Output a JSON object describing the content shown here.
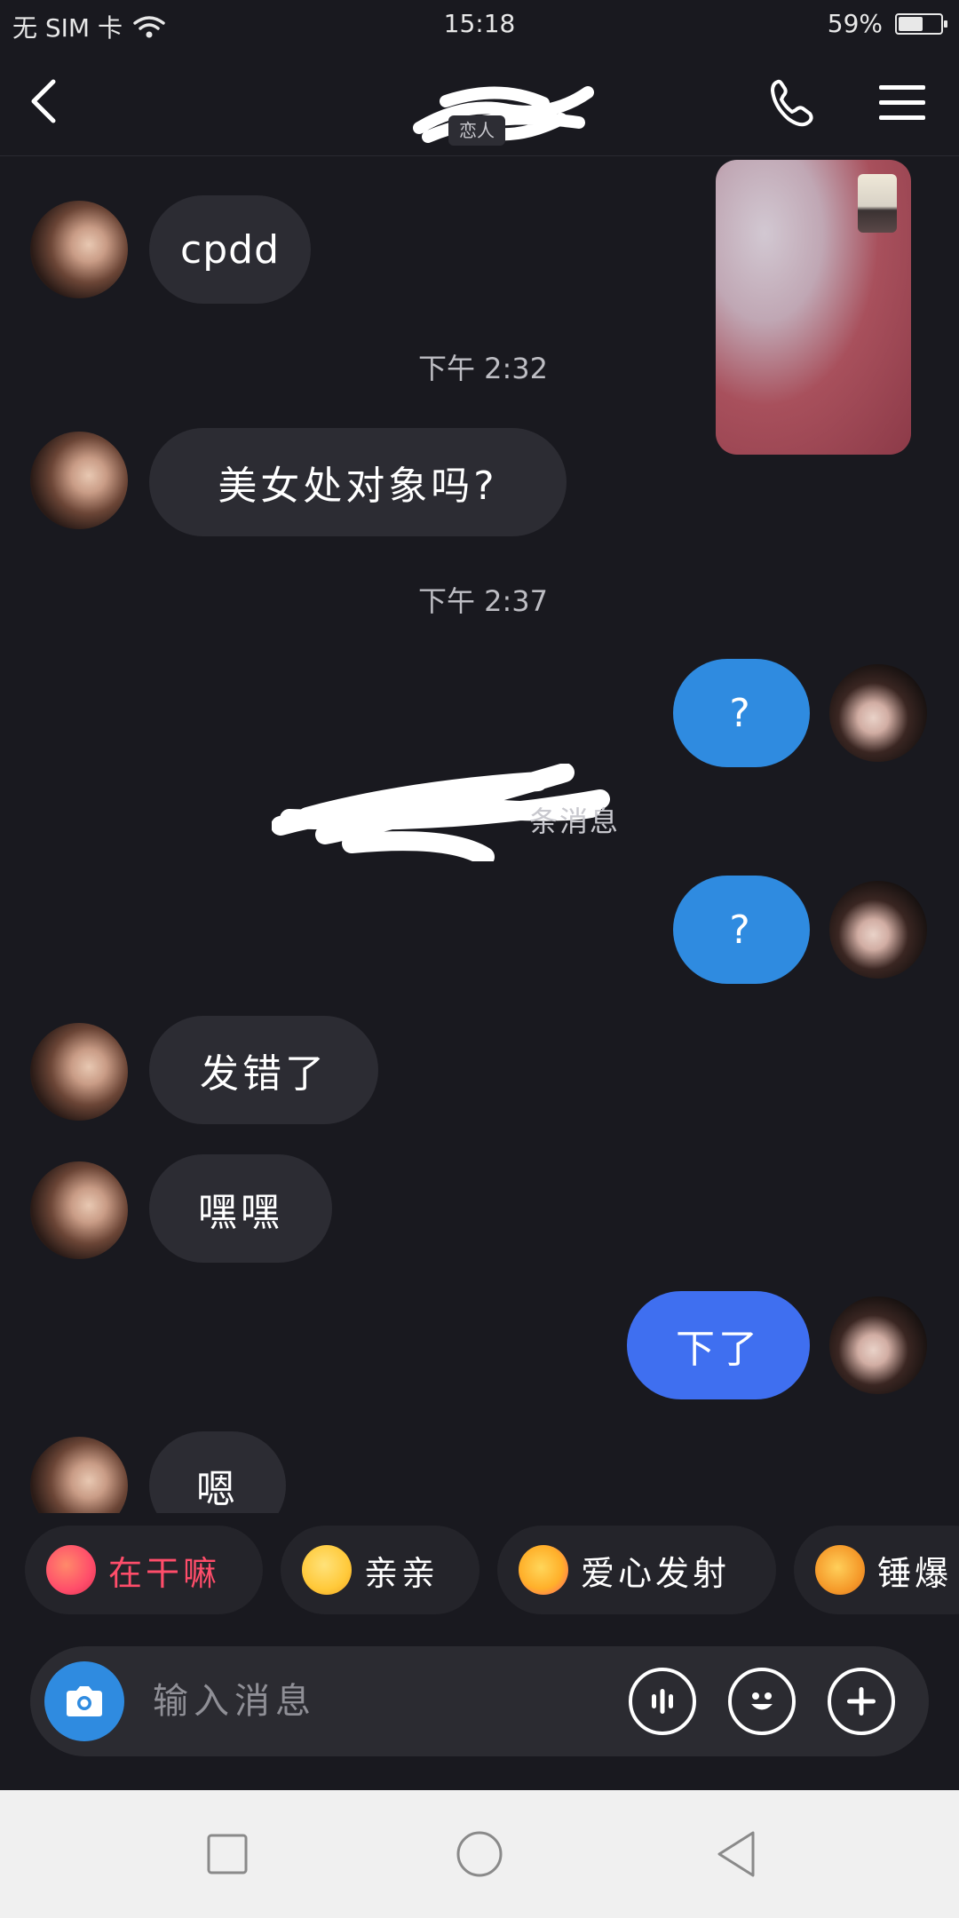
{
  "status_bar": {
    "carrier": "无 SIM 卡",
    "time": "15:18",
    "battery_text": "59%",
    "battery_level": 0.59
  },
  "header": {
    "relation_tag": "恋人"
  },
  "messages": [
    {
      "side": "in",
      "text": "cpdd"
    },
    {
      "type": "time",
      "text": "下午 2:32"
    },
    {
      "side": "in",
      "text": "美女处对象吗?"
    },
    {
      "type": "time",
      "text": "下午 2:37"
    },
    {
      "side": "out",
      "text": "?"
    },
    {
      "type": "notice",
      "text": "条消息"
    },
    {
      "side": "out",
      "text": "?"
    },
    {
      "side": "in",
      "text": "发错了"
    },
    {
      "side": "in",
      "text": "嘿嘿"
    },
    {
      "side": "out",
      "text": "下了"
    },
    {
      "side": "in",
      "text": "嗯"
    }
  ],
  "quick_replies": [
    {
      "label": "在干嘛",
      "color": "#ff4d6a",
      "icon": "gift-bag-emoji-icon"
    },
    {
      "label": "亲亲",
      "color": "#ffffff",
      "icon": "hug-emoji-icon"
    },
    {
      "label": "爱心发射",
      "color": "#ffffff",
      "icon": "heart-eyes-emoji-icon"
    },
    {
      "label": "锤爆",
      "color": "#ffffff",
      "icon": "hammer-emoji-icon"
    }
  ],
  "input": {
    "placeholder": "输入消息"
  },
  "colors": {
    "background": "#19191f",
    "bubble_in": "#2c2c33",
    "bubble_out": "#2f8be0",
    "bubble_out_alt": "#3f6ff0",
    "accent_pink": "#ff4d6a"
  }
}
